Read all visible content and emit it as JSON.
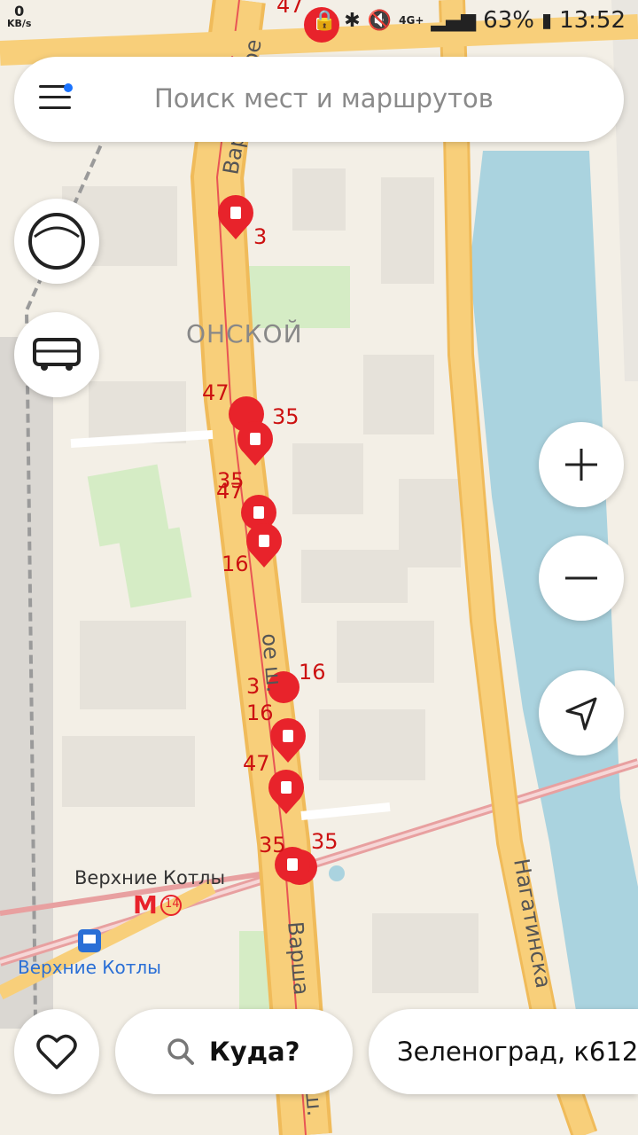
{
  "status_bar": {
    "net_speed_value": "0",
    "net_speed_unit": "KB/s",
    "network": "4G+",
    "battery": "63%",
    "time": "13:52"
  },
  "search": {
    "placeholder": "Поиск мест и маршрутов"
  },
  "map": {
    "district_label": "ОНСКОЙ",
    "station_label": "Верхние Котлы",
    "metro_line": "14",
    "railway_station_label": "Верхние Котлы",
    "street_varshavskoe_top": "Варшавское",
    "street_varshavskoe_mid": "ое ш.",
    "street_varshavskoe_bottom": "Варша",
    "street_varshavskoe_bottom2": "ш.",
    "street_nagatinskaya": "Нагатинска",
    "markers": [
      "47",
      "3",
      "35",
      "47",
      "35",
      "16",
      "3",
      "16",
      "16",
      "47",
      "35",
      "35"
    ]
  },
  "bottom": {
    "where_label": "Куда?",
    "route_label": "Зеленоград, к612"
  },
  "colors": {
    "marker": "#e8232b",
    "road": "#f6c86a",
    "water": "#aad3df",
    "park": "#d5ecc5"
  }
}
